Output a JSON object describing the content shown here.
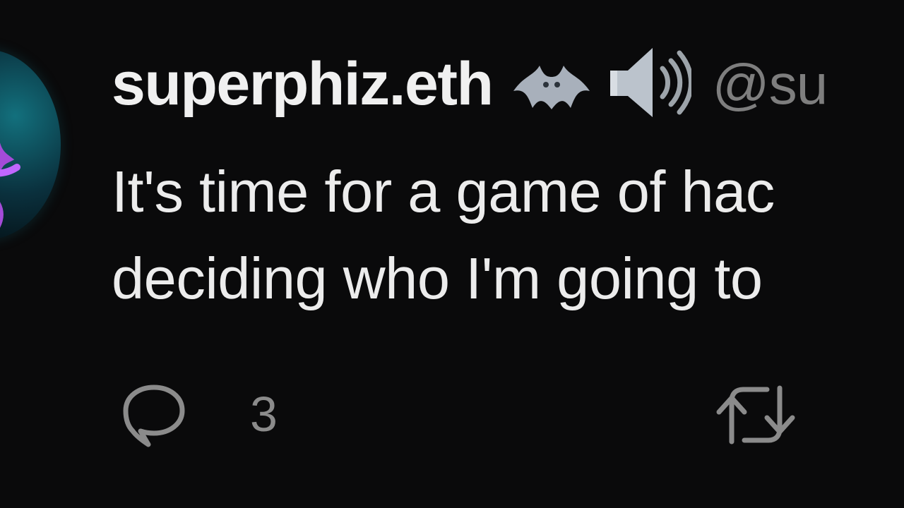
{
  "tweet": {
    "author": {
      "display_name": "superphiz.eth",
      "handle": "@su",
      "emojis": [
        "bat-emoji",
        "speaker-emoji"
      ]
    },
    "body_lines": [
      "It's time for a game of hac",
      "deciding who I'm going to"
    ],
    "actions": {
      "reply": {
        "icon": "speech-bubble-icon",
        "count": "3"
      },
      "retweet": {
        "icon": "retweet-icon"
      }
    }
  },
  "colors": {
    "background": "#0a0a0b",
    "text": "#ececec",
    "handle": "#7e7e7e",
    "icon": "#8b8b8b"
  }
}
